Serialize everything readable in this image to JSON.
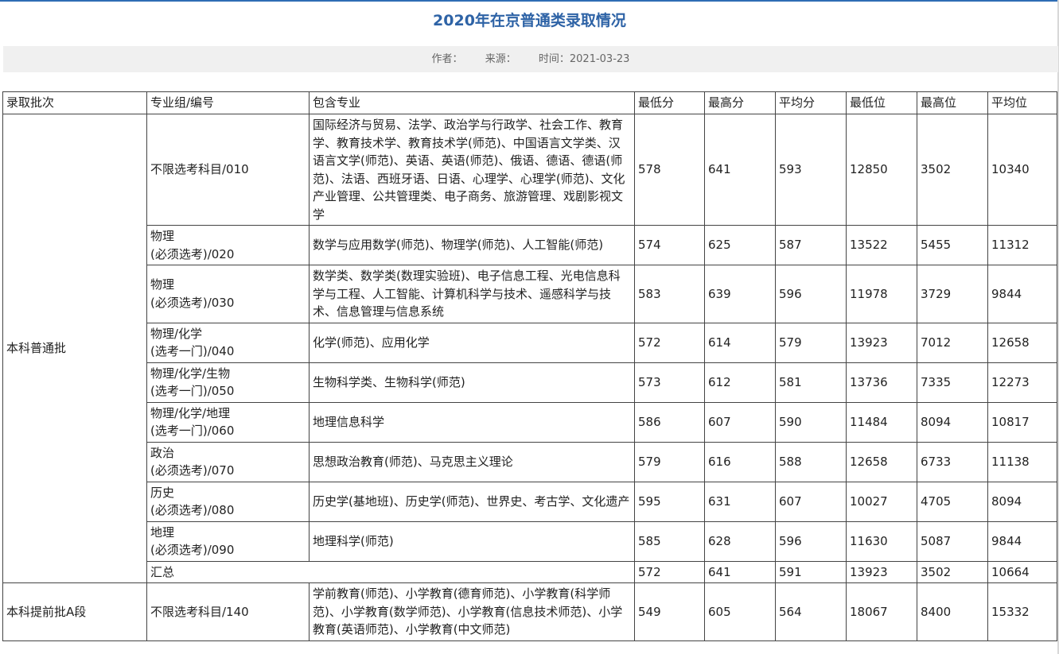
{
  "title": "2020年在京普通类录取情况",
  "meta": {
    "author_label": "作者：",
    "source_label": "来源：",
    "time_label": "时间：",
    "time_value": "2021-03-23"
  },
  "table": {
    "headers": [
      "录取批次",
      "专业组/编号",
      "包含专业",
      "最低分",
      "最高分",
      "平均分",
      "最低位",
      "最高位",
      "平均位"
    ],
    "batch1": "本科普通批",
    "batch2": "本科提前批A段",
    "rows": [
      {
        "group": [
          "不限选考科目/010"
        ],
        "majors": "国际经济与贸易、法学、政治学与行政学、社会工作、教育学、教育技术学、教育技术学(师范)、中国语言文学类、汉语言文学(师范)、英语、英语(师范)、俄语、德语、德语(师范)、法语、西班牙语、日语、心理学、心理学(师范)、文化产业管理、公共管理类、电子商务、旅游管理、戏剧影视文学",
        "min": "578",
        "max": "641",
        "avg": "593",
        "minr": "12850",
        "maxr": "3502",
        "avgr": "10340"
      },
      {
        "group": [
          "物理",
          "(必须选考)/020"
        ],
        "majors": "数学与应用数学(师范)、物理学(师范)、人工智能(师范)",
        "min": "574",
        "max": "625",
        "avg": "587",
        "minr": "13522",
        "maxr": "5455",
        "avgr": "11312"
      },
      {
        "group": [
          "物理",
          "(必须选考)/030"
        ],
        "majors": "数学类、数学类(数理实验班)、电子信息工程、光电信息科学与工程、人工智能、计算机科学与技术、遥感科学与技术、信息管理与信息系统",
        "min": "583",
        "max": "639",
        "avg": "596",
        "minr": "11978",
        "maxr": "3729",
        "avgr": "9844"
      },
      {
        "group": [
          "物理/化学",
          "(选考一门)/040"
        ],
        "majors": "化学(师范)、应用化学",
        "min": "572",
        "max": "614",
        "avg": "579",
        "minr": "13923",
        "maxr": "7012",
        "avgr": "12658"
      },
      {
        "group": [
          "物理/化学/生物",
          "(选考一门)/050"
        ],
        "majors": "生物科学类、生物科学(师范)",
        "min": "573",
        "max": "612",
        "avg": "581",
        "minr": "13736",
        "maxr": "7335",
        "avgr": "12273"
      },
      {
        "group": [
          "物理/化学/地理",
          "(选考一门)/060"
        ],
        "majors": "地理信息科学",
        "min": "586",
        "max": "607",
        "avg": "590",
        "minr": "11484",
        "maxr": "8094",
        "avgr": "10817"
      },
      {
        "group": [
          "政治",
          "(必须选考)/070"
        ],
        "majors": "思想政治教育(师范)、马克思主义理论",
        "min": "579",
        "max": "616",
        "avg": "588",
        "minr": "12658",
        "maxr": "6733",
        "avgr": "11138"
      },
      {
        "group": [
          "历史",
          "(必须选考)/080"
        ],
        "majors": "历史学(基地班)、历史学(师范)、世界史、考古学、文化遗产",
        "min": "595",
        "max": "631",
        "avg": "607",
        "minr": "10027",
        "maxr": "4705",
        "avgr": "8094"
      },
      {
        "group": [
          "地理",
          "(必须选考)/090"
        ],
        "majors": "地理科学(师范)",
        "min": "585",
        "max": "628",
        "avg": "596",
        "minr": "11630",
        "maxr": "5087",
        "avgr": "9844"
      }
    ],
    "summary": {
      "label": "汇总",
      "min": "572",
      "max": "641",
      "avg": "591",
      "minr": "13923",
      "maxr": "3502",
      "avgr": "10664"
    },
    "early": {
      "group": "不限选考科目/140",
      "majors": "学前教育(师范)、小学教育(德育师范)、小学教育(科学师范)、小学教育(数学师范)、小学教育(信息技术师范)、小学教育(英语师范)、小学教育(中文师范)",
      "min": "549",
      "max": "605",
      "avg": "564",
      "minr": "18067",
      "maxr": "8400",
      "avgr": "15332"
    }
  }
}
